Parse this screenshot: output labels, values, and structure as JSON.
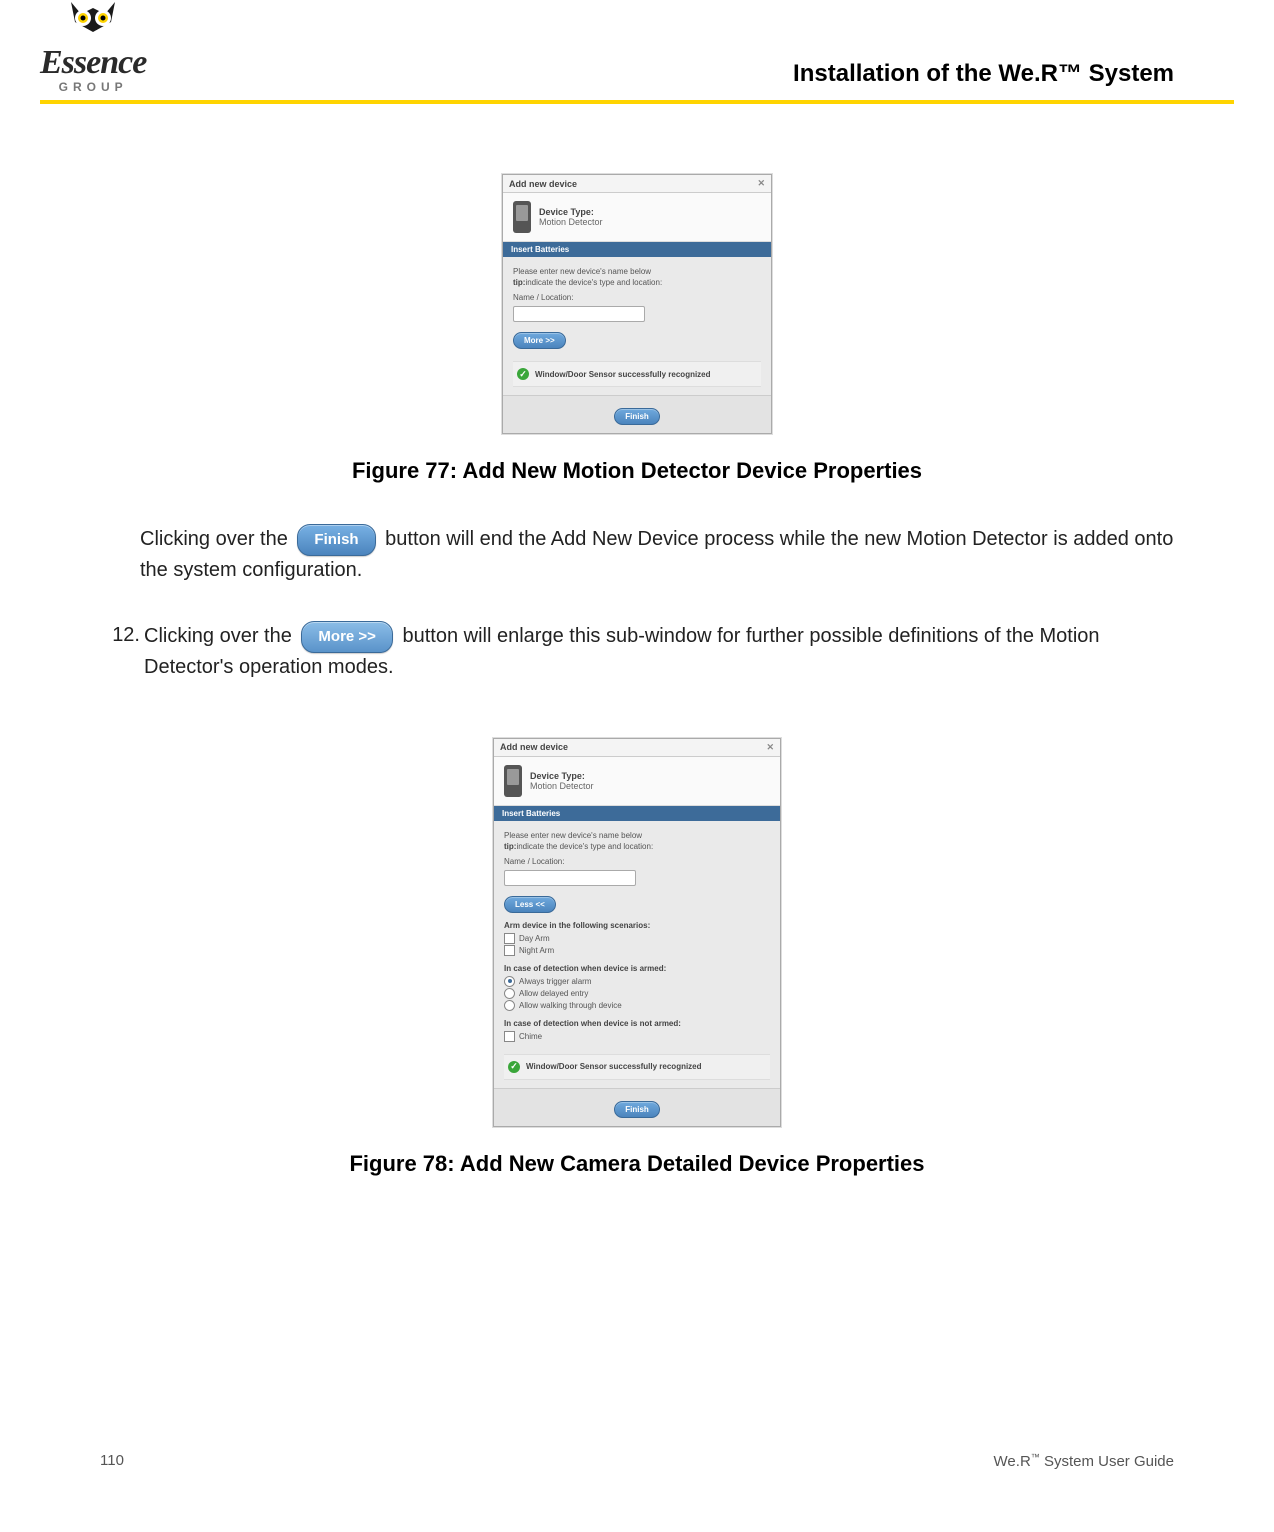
{
  "brand": {
    "name": "Essence",
    "sub": "GROUP"
  },
  "doc_title": "Installation of the We.R™ System",
  "figure77": {
    "caption": "Figure 77: Add New Motion Detector Device Properties",
    "dialog": {
      "title": "Add new device",
      "device_type_label": "Device Type:",
      "device_type_value": "Motion Detector",
      "bluebar": "Insert Batteries",
      "line1": "Please enter new device's name below",
      "tip_label": "tip:",
      "tip_text": "indicate the device's type and location:",
      "name_label": "Name / Location:",
      "more_btn": "More >>",
      "status": "Window/Door Sensor successfully recognized",
      "finish_btn": "Finish"
    }
  },
  "para1_before": "Clicking over the ",
  "finish_pill": "Finish",
  "para1_after": " button will end the Add New Device process while the new Motion Detector is added onto the system configuration.",
  "step12_num": "12.",
  "step12_before": "Clicking over the ",
  "more_pill": "More >>",
  "step12_after": " button will enlarge this sub-window for further possible definitions of the Motion Detector's operation modes.",
  "figure78": {
    "caption": "Figure 78: Add New Camera Detailed Device Properties",
    "dialog": {
      "title": "Add new device",
      "device_type_label": "Device Type:",
      "device_type_value": "Motion Detector",
      "bluebar": "Insert Batteries",
      "line1": "Please enter new device's name below",
      "tip_label": "tip:",
      "tip_text": "indicate the device's type and location:",
      "name_label": "Name / Location:",
      "less_btn": "Less <<",
      "arm_header": "Arm device in the following scenarios:",
      "chk_day": "Day Arm",
      "chk_night": "Night Arm",
      "det_armed_header": "In case of detection when device is armed:",
      "rad1": "Always trigger alarm",
      "rad2": "Allow delayed entry",
      "rad3": "Allow walking through device",
      "det_notarmed_header": "In case of detection when device is not armed:",
      "chk_chime": "Chime",
      "status": "Window/Door Sensor successfully recognized",
      "finish_btn": "Finish"
    }
  },
  "footer": {
    "page": "110",
    "guide_prefix": "We.R",
    "guide_suffix": " System User Guide"
  }
}
